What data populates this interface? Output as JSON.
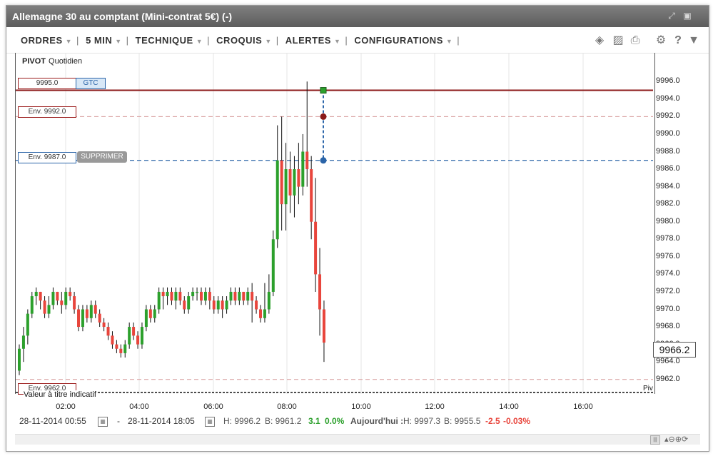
{
  "window": {
    "title": "Allemagne 30 au comptant (Mini-contrat 5€) (-)",
    "controls": [
      "expand-icon",
      "restore-icon"
    ]
  },
  "toolbar": {
    "menus": [
      {
        "label": "ORDRES"
      },
      {
        "label": "5 MIN"
      },
      {
        "label": "TECHNIQUE"
      },
      {
        "label": "CROQUIS"
      },
      {
        "label": "ALERTES"
      },
      {
        "label": "CONFIGURATIONS"
      }
    ],
    "icons": [
      "layers-icon",
      "image-icon",
      "print-icon",
      "gear-icon",
      "help-icon",
      "pin-icon"
    ]
  },
  "chart_header": {
    "pivot_label": "PIVOT",
    "pivot_period": "Quotidien"
  },
  "order_lines": {
    "gtc_value": "9995.0",
    "gtc_label": "GTC",
    "env_upper": "Env. 9992.0",
    "env_mid": "Env. 9987.0",
    "supprimer": "SUPPRIMER",
    "env_lower": "Env. 9962.0"
  },
  "valeur_text": "Valeur à titre indicatif",
  "piv_text": "Piv",
  "current_price": "9966.2",
  "footer": {
    "date_from": "28-11-2014 00:55",
    "dash": "-",
    "date_to": "28-11-2014 18:05",
    "high": "H: 9996.2",
    "low": "B: 9961.2",
    "change": "3.1",
    "change_pct": "0.0%",
    "today_label": "Aujourd'hui :",
    "today_high": "H: 9997.3",
    "today_low": "B: 9955.5",
    "today_change": "-2.5",
    "today_pct": "-0.03%"
  },
  "colors": {
    "up": "#2ca02c",
    "down": "#e8453c",
    "order_red": "#8b1a1a",
    "order_blue": "#2a64a8"
  },
  "chart_data": {
    "type": "candlestick",
    "ylim": [
      9961,
      9997
    ],
    "y_ticks": [
      "9996.0",
      "9994.0",
      "9992.0",
      "9990.0",
      "9988.0",
      "9986.0",
      "9984.0",
      "9982.0",
      "9980.0",
      "9978.0",
      "9976.0",
      "9974.0",
      "9972.0",
      "9970.0",
      "9968.0",
      "9966.0",
      "9964.0",
      "9962.0"
    ],
    "x_ticks": [
      "02:00",
      "04:00",
      "06:00",
      "08:00",
      "10:00",
      "12:00",
      "14:00",
      "16:00"
    ],
    "lines": {
      "gtc": 9995.0,
      "env_upper": 9992.0,
      "env_mid": 9987.0,
      "env_lower": 9962.0
    },
    "candles": [
      [
        9963.0,
        9965.5,
        9962.5,
        9966.0
      ],
      [
        9965.5,
        9967.0,
        9964.0,
        9968.0
      ],
      [
        9967.0,
        9969.5,
        9966.0,
        9970.0
      ],
      [
        9969.5,
        9971.5,
        9969.0,
        9972.0
      ],
      [
        9971.5,
        9972.0,
        9970.5,
        9972.5
      ],
      [
        9972.0,
        9971.0,
        9970.0,
        9972.0
      ],
      [
        9971.0,
        9969.5,
        9969.0,
        9971.5
      ],
      [
        9969.5,
        9970.5,
        9969.0,
        9971.5
      ],
      [
        9970.5,
        9972.0,
        9970.0,
        9972.5
      ],
      [
        9972.0,
        9971.0,
        9970.5,
        9972.0
      ],
      [
        9971.0,
        9970.5,
        9969.5,
        9972.0
      ],
      [
        9970.5,
        9972.0,
        9970.0,
        9972.5
      ],
      [
        9972.0,
        9971.5,
        9971.0,
        9972.5
      ],
      [
        9971.5,
        9970.0,
        9969.5,
        9972.0
      ],
      [
        9970.0,
        9968.0,
        9967.5,
        9970.5
      ],
      [
        9968.0,
        9970.0,
        9967.5,
        9970.5
      ],
      [
        9970.0,
        9969.0,
        9968.5,
        9970.5
      ],
      [
        9969.0,
        9970.5,
        9968.5,
        9971.0
      ],
      [
        9970.5,
        9969.5,
        9969.0,
        9971.0
      ],
      [
        9969.5,
        9968.5,
        9968.0,
        9970.0
      ],
      [
        9968.5,
        9968.0,
        9967.5,
        9969.0
      ],
      [
        9968.0,
        9967.0,
        9966.5,
        9968.5
      ],
      [
        9967.0,
        9966.0,
        9965.5,
        9967.5
      ],
      [
        9966.0,
        9965.5,
        9965.0,
        9966.5
      ],
      [
        9965.5,
        9965.0,
        9964.5,
        9966.0
      ],
      [
        9965.0,
        9966.0,
        9964.5,
        9966.5
      ],
      [
        9966.0,
        9968.0,
        9965.5,
        9968.5
      ],
      [
        9968.0,
        9967.0,
        9966.5,
        9968.5
      ],
      [
        9967.0,
        9966.0,
        9965.5,
        9967.5
      ],
      [
        9966.0,
        9968.0,
        9965.5,
        9968.5
      ],
      [
        9968.0,
        9970.0,
        9967.5,
        9970.5
      ],
      [
        9970.0,
        9969.0,
        9968.5,
        9970.5
      ],
      [
        9969.0,
        9970.0,
        9968.5,
        9970.5
      ],
      [
        9970.0,
        9972.0,
        9969.5,
        9972.5
      ],
      [
        9972.0,
        9971.5,
        9970.0,
        9972.5
      ],
      [
        9971.5,
        9972.0,
        9970.5,
        9972.5
      ],
      [
        9972.0,
        9971.0,
        9970.5,
        9972.5
      ],
      [
        9971.0,
        9972.0,
        9970.0,
        9972.5
      ],
      [
        9972.0,
        9971.0,
        9970.5,
        9972.5
      ],
      [
        9971.0,
        9970.0,
        9969.5,
        9971.5
      ],
      [
        9970.0,
        9971.5,
        9969.5,
        9972.0
      ],
      [
        9971.5,
        9972.0,
        9971.0,
        9972.5
      ],
      [
        9972.0,
        9972.0,
        9971.0,
        9972.5
      ],
      [
        9972.0,
        9971.0,
        9970.5,
        9972.5
      ],
      [
        9971.0,
        9972.0,
        9970.5,
        9972.5
      ],
      [
        9972.0,
        9971.0,
        9970.0,
        9972.5
      ],
      [
        9971.0,
        9970.0,
        9969.5,
        9971.5
      ],
      [
        9970.0,
        9971.0,
        9969.5,
        9971.5
      ],
      [
        9971.0,
        9970.0,
        9969.0,
        9971.5
      ],
      [
        9970.0,
        9971.0,
        9969.5,
        9971.5
      ],
      [
        9971.0,
        9972.0,
        9970.5,
        9972.5
      ],
      [
        9972.0,
        9971.0,
        9970.5,
        9972.5
      ],
      [
        9971.0,
        9972.0,
        9970.5,
        9972.5
      ],
      [
        9972.0,
        9971.0,
        9970.5,
        9972.0
      ],
      [
        9971.0,
        9972.0,
        9970.5,
        9972.5
      ],
      [
        9972.0,
        9971.0,
        9968.5,
        9973.0
      ],
      [
        9971.0,
        9970.0,
        9969.5,
        9971.5
      ],
      [
        9970.0,
        9969.0,
        9968.5,
        9970.5
      ],
      [
        9969.0,
        9970.0,
        9968.5,
        9973.0
      ],
      [
        9970.0,
        9972.0,
        9969.5,
        9974.0
      ],
      [
        9972.0,
        9978.0,
        9971.5,
        9979.0
      ],
      [
        9978.0,
        9987.0,
        9977.0,
        9991.0
      ],
      [
        9987.0,
        9982.0,
        9979.0,
        9992.0
      ],
      [
        9982.0,
        9986.0,
        9979.0,
        9989.0
      ],
      [
        9986.0,
        9983.0,
        9981.0,
        9988.0
      ],
      [
        9983.0,
        9986.0,
        9980.5,
        9987.5
      ],
      [
        9986.0,
        9984.0,
        9982.0,
        9989.0
      ],
      [
        9984.0,
        9988.0,
        9983.0,
        9990.0
      ],
      [
        9988.0,
        9986.0,
        9984.0,
        9996.0
      ],
      [
        9986.0,
        9980.0,
        9978.0,
        9987.5
      ],
      [
        9980.0,
        9974.0,
        9972.0,
        9985.0
      ],
      [
        9974.0,
        9970.0,
        9967.0,
        9977.0
      ],
      [
        9970.0,
        9966.2,
        9964.0,
        9971.0
      ]
    ]
  }
}
